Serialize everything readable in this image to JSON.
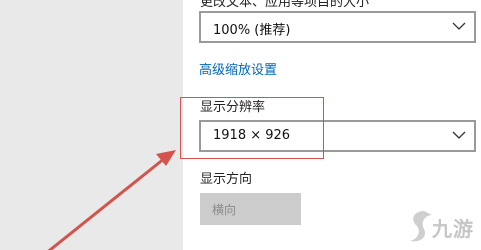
{
  "scale": {
    "clipped_label": "更改文本、应用等项目的大小",
    "selected": "100% (推荐)"
  },
  "advanced_scaling_link": "高级缩放设置",
  "resolution": {
    "label": "显示分辨率",
    "selected": "1918 × 926"
  },
  "orientation": {
    "label": "显示方向",
    "selected": "横向"
  },
  "icons": [
    "chevron-down-icon",
    "chevron-down-icon",
    "red-arrow-annotation",
    "jiuyou-logo"
  ],
  "colors": {
    "link": "#0067b8",
    "annotation_red": "#d2544d",
    "left_pane": "#e9e9e9",
    "disabled_field": "#cccccc"
  },
  "watermark": {
    "text": "九游"
  }
}
